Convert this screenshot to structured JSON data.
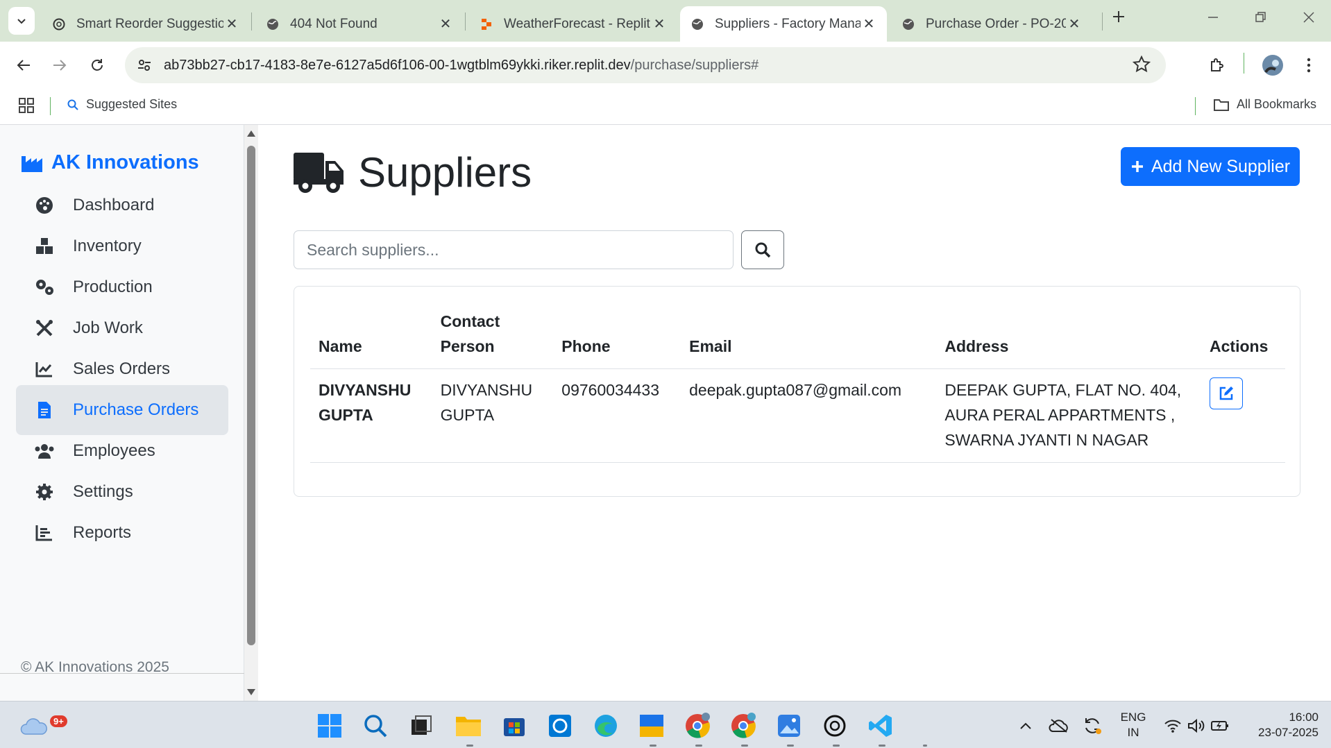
{
  "browser": {
    "tabs": [
      {
        "title": "Smart Reorder Suggestio",
        "icon": "openai-icon",
        "active": false
      },
      {
        "title": "404 Not Found",
        "icon": "globe-icon",
        "active": false
      },
      {
        "title": "WeatherForecast - Replit",
        "icon": "replit-icon",
        "active": false
      },
      {
        "title": "Suppliers - Factory Mana",
        "icon": "globe-icon",
        "active": true
      },
      {
        "title": "Purchase Order - PO-202",
        "icon": "globe-icon",
        "active": false
      }
    ],
    "url_host": "ab73bb27-cb17-4183-8e7e-6127a5d6f106-00-1wgtblm69ykki.riker.replit.dev",
    "url_path": "/purchase/suppliers#",
    "bookmarks": {
      "suggested": "Suggested Sites",
      "all": "All Bookmarks"
    }
  },
  "sidebar": {
    "brand": "AK Innovations",
    "items": [
      {
        "label": "Dashboard",
        "icon": "palette-icon"
      },
      {
        "label": "Inventory",
        "icon": "boxes-icon"
      },
      {
        "label": "Production",
        "icon": "gears-icon"
      },
      {
        "label": "Job Work",
        "icon": "tools-icon"
      },
      {
        "label": "Sales Orders",
        "icon": "line-chart-icon"
      },
      {
        "label": "Purchase Orders",
        "icon": "file-invoice-icon",
        "active": true
      },
      {
        "label": "Employees",
        "icon": "users-icon"
      },
      {
        "label": "Settings",
        "icon": "gear-icon"
      },
      {
        "label": "Reports",
        "icon": "bar-chart-icon"
      }
    ],
    "footer": "© AK Innovations 2025"
  },
  "main": {
    "title": "Suppliers",
    "add_button": "Add New Supplier",
    "search_placeholder": "Search suppliers...",
    "table": {
      "headers": {
        "name": "Name",
        "contact": "Contact Person",
        "phone": "Phone",
        "email": "Email",
        "address": "Address",
        "actions": "Actions"
      },
      "rows": [
        {
          "name": "DIVYANSHU GUPTA",
          "contact": "DIVYANSHU GUPTA",
          "phone": "09760034433",
          "email": "deepak.gupta087@gmail.com",
          "address": "DEEPAK GUPTA, FLAT NO. 404, AURA PERAL APPARTMENTS , SWARNA JYANTI N NAGAR"
        }
      ]
    }
  },
  "taskbar": {
    "weather_badge": "9+",
    "lang_top": "ENG",
    "lang_bottom": "IN",
    "time": "16:00",
    "date": "23-07-2025"
  },
  "colors": {
    "primary": "#0d6efd",
    "sidebar_bg": "#f8f9fa",
    "active_nav_bg": "#e2e6ea"
  }
}
